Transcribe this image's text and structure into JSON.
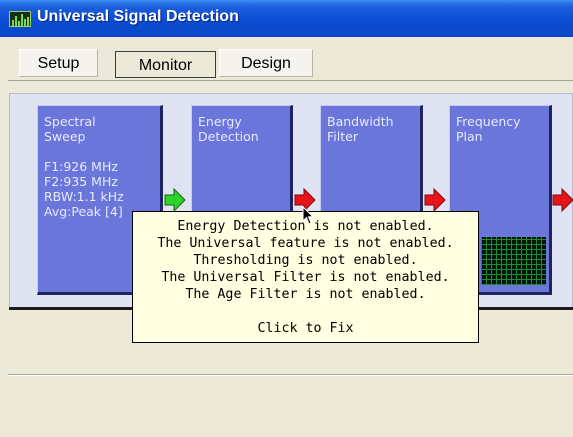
{
  "window": {
    "title": "Universal Signal Detection",
    "icon": "spectrum-app-icon"
  },
  "tabs": [
    {
      "label": "Setup",
      "active": false
    },
    {
      "label": "Monitor",
      "active": true
    },
    {
      "label": "Design",
      "active": false
    }
  ],
  "blocks": [
    {
      "title_lines": [
        "Spectral",
        "Sweep"
      ],
      "detail_lines": [
        "F1:926 MHz",
        "F2:935 MHz",
        "RBW:1.1 kHz",
        "Avg:Peak [4]"
      ]
    },
    {
      "title_lines": [
        "Energy",
        "Detection"
      ]
    },
    {
      "title_lines": [
        "Bandwidth",
        "Filter"
      ]
    },
    {
      "title_lines": [
        "Frequency",
        "Plan"
      ]
    }
  ],
  "arrows": [
    {
      "color": "#2fd12b",
      "icon": "arrow-right-icon"
    },
    {
      "color": "#e8141a",
      "icon": "arrow-right-icon"
    },
    {
      "color": "#e8141a",
      "icon": "arrow-right-icon"
    },
    {
      "color": "#e8141a",
      "icon": "arrow-right-icon"
    }
  ],
  "tooltip": {
    "messages": [
      "Energy Detection is not enabled.",
      "The Universal feature is not enabled.",
      "Thresholding is not enabled.",
      "The Universal Filter is not enabled.",
      "The Age Filter is not enabled."
    ],
    "action": "Click to Fix"
  },
  "colors": {
    "block_fill": "#6b76da",
    "arrow_ok": "#2fd12b",
    "arrow_error": "#e8141a",
    "tooltip_bg": "#ffffe1"
  }
}
